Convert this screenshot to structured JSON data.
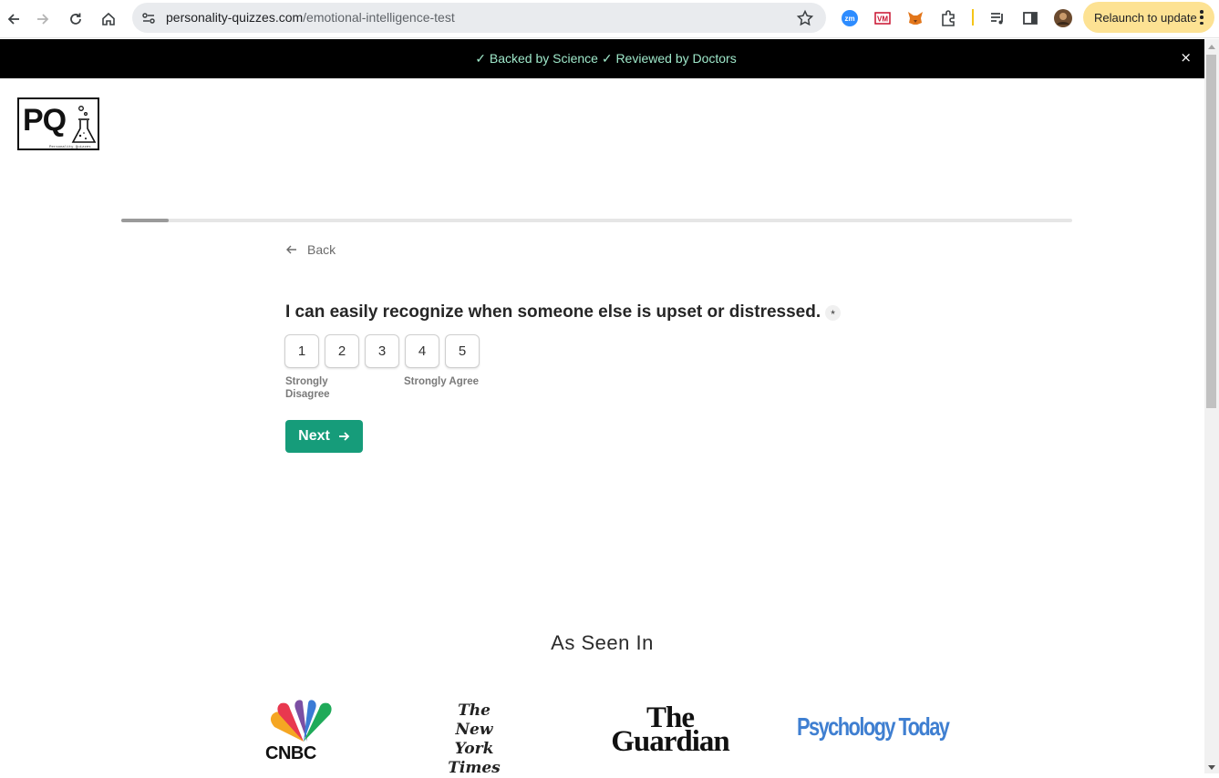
{
  "browser": {
    "url_domain": "personality-quizzes.com",
    "url_path": "/emotional-intelligence-test",
    "relaunch_label": "Relaunch to update"
  },
  "banner": {
    "text": "✓ Backed by Science ✓ Reviewed by Doctors",
    "close": "×"
  },
  "logo": {
    "letters": "PQ",
    "tagline": "Personality Quizzes"
  },
  "progress": {
    "fraction": 0.05
  },
  "back_label": "Back",
  "question": {
    "text": "I can easily recognize when someone else is upset or distressed.",
    "required_mark": "*",
    "options": [
      "1",
      "2",
      "3",
      "4",
      "5"
    ],
    "label_low": "Strongly Disagree",
    "label_high": "Strongly Agree"
  },
  "next_label": "Next",
  "as_seen_in": {
    "heading": "As Seen In",
    "cnbc": "CNBC",
    "nyt": "The New York Times",
    "guardian": "The Guardian",
    "psych": "Psychology Today"
  },
  "colors": {
    "accent": "#169c7a",
    "banner_text": "#9ee7c9",
    "psych_blue": "#3f7fd1"
  }
}
